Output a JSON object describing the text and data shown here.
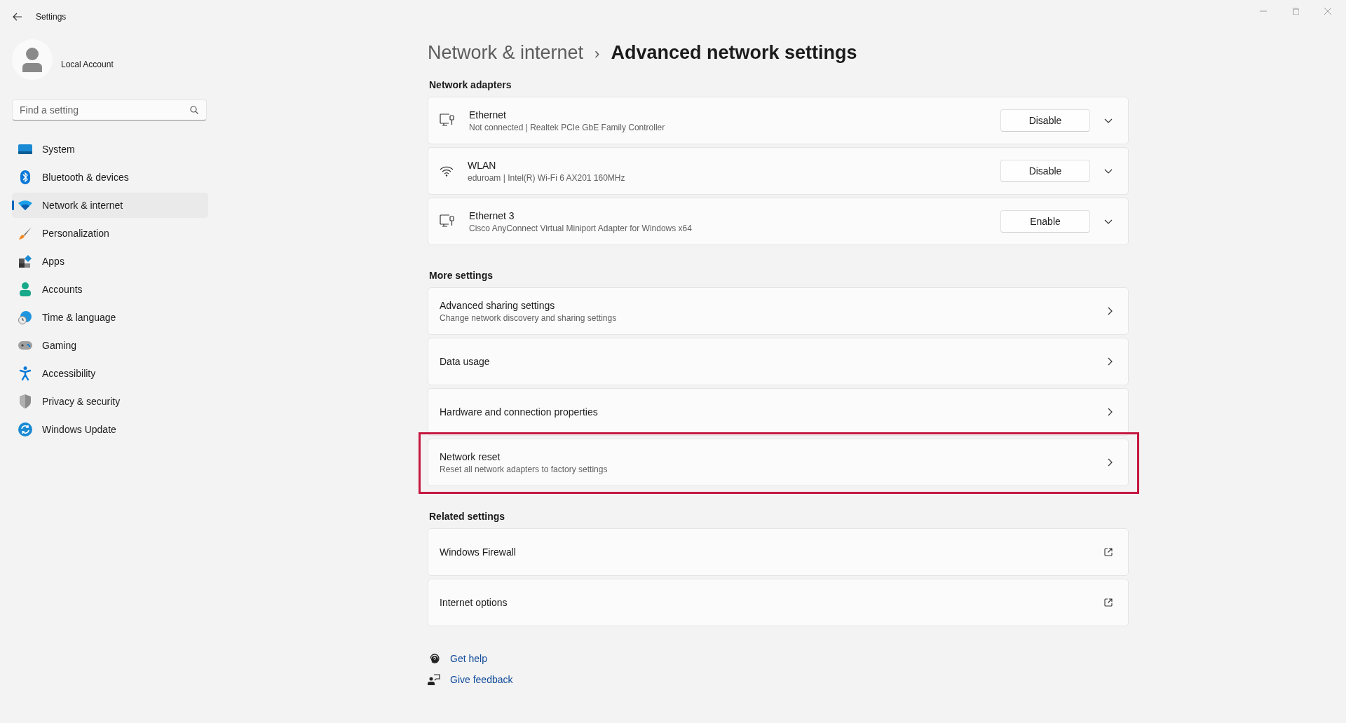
{
  "window": {
    "title": "Settings"
  },
  "account": {
    "name": "Local Account"
  },
  "search": {
    "placeholder": "Find a setting"
  },
  "sidebar": {
    "items": [
      {
        "label": "System",
        "selected": false
      },
      {
        "label": "Bluetooth & devices",
        "selected": false
      },
      {
        "label": "Network & internet",
        "selected": true
      },
      {
        "label": "Personalization",
        "selected": false
      },
      {
        "label": "Apps",
        "selected": false
      },
      {
        "label": "Accounts",
        "selected": false
      },
      {
        "label": "Time & language",
        "selected": false
      },
      {
        "label": "Gaming",
        "selected": false
      },
      {
        "label": "Accessibility",
        "selected": false
      },
      {
        "label": "Privacy & security",
        "selected": false
      },
      {
        "label": "Windows Update",
        "selected": false
      }
    ]
  },
  "breadcrumb": {
    "parent": "Network & internet",
    "separator": "›",
    "current": "Advanced network settings"
  },
  "sections": [
    {
      "title": "Network adapters",
      "items": [
        {
          "kind": "wired",
          "title": "Ethernet",
          "subtitle": "Not connected | Realtek PCIe GbE Family Controller",
          "button": "Disable",
          "highlighted": false
        },
        {
          "kind": "wireless",
          "title": "WLAN",
          "subtitle": "eduroam | Intel(R) Wi-Fi 6 AX201 160MHz",
          "button": "Disable",
          "highlighted": false
        },
        {
          "kind": "wired",
          "title": "Ethernet 3",
          "subtitle": "Cisco AnyConnect Virtual Miniport Adapter for Windows x64",
          "button": "Enable",
          "highlighted": false
        }
      ]
    },
    {
      "title": "More settings",
      "items": [
        {
          "kind": "link",
          "title": "Advanced sharing settings",
          "subtitle": "Change network discovery and sharing settings",
          "highlighted": false
        },
        {
          "kind": "link",
          "title": "Data usage",
          "highlighted": false
        },
        {
          "kind": "link",
          "title": "Hardware and connection properties",
          "highlighted": false
        },
        {
          "kind": "link",
          "title": "Network reset",
          "subtitle": "Reset all network adapters to factory settings",
          "highlighted": true
        }
      ]
    },
    {
      "title": "Related settings",
      "items": [
        {
          "kind": "external",
          "title": "Windows Firewall",
          "highlighted": false
        },
        {
          "kind": "external",
          "title": "Internet options",
          "highlighted": false
        }
      ]
    }
  ],
  "help_links": [
    {
      "kind": "help",
      "label": "Get help"
    },
    {
      "kind": "feedback",
      "label": "Give feedback"
    }
  ]
}
